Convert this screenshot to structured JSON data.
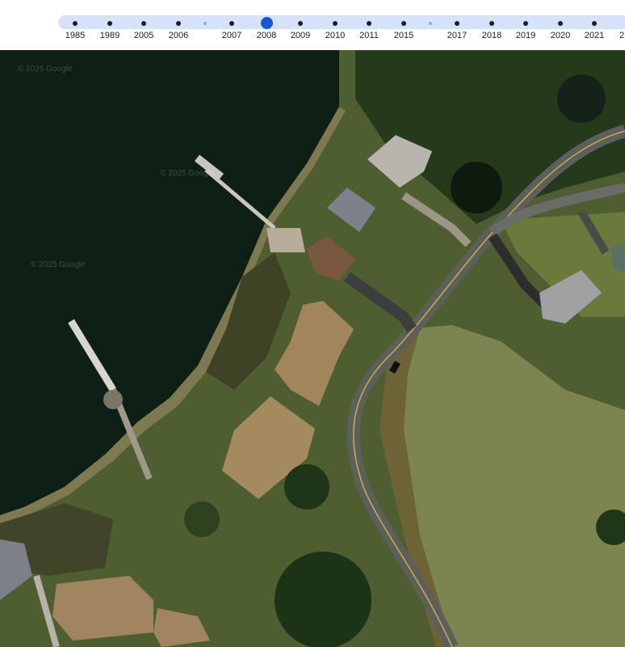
{
  "timeline": {
    "years": [
      "1985",
      "1989",
      "2005",
      "2006",
      "2007",
      "2008",
      "2009",
      "2010",
      "2011",
      "2015",
      "2017",
      "2018",
      "2019",
      "2020",
      "2021",
      "2"
    ],
    "selected_year": "2008"
  },
  "map": {
    "attribution": "© 2025 Google",
    "view": "satellite"
  },
  "colors": {
    "track": "#d6e2fa",
    "selected_dot": "#1a55d6",
    "water": "#0e2016",
    "grass": "#6f7d43",
    "road": "#5d5f5c"
  }
}
